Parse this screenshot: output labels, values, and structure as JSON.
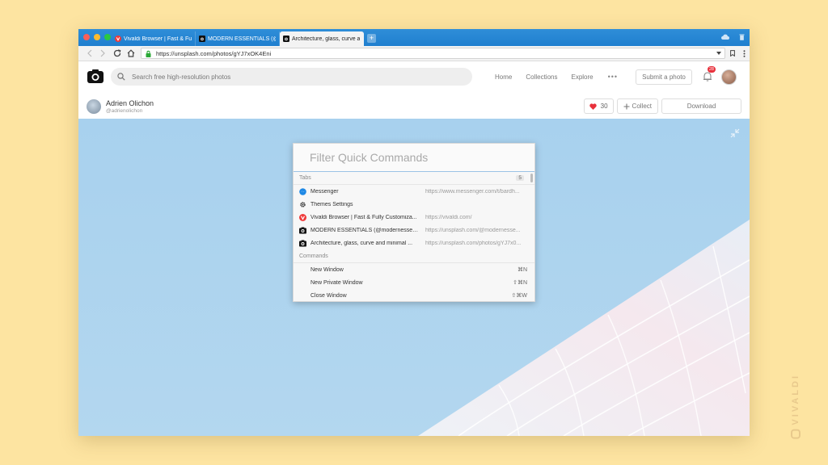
{
  "browser": {
    "tabs": [
      {
        "label": "Vivaldi Browser | Fast & Fully C",
        "favicon": "vivaldi-icon",
        "active": false
      },
      {
        "label": "MODERN ESSENTIALS (@moder",
        "favicon": "camera-icon",
        "active": false
      },
      {
        "label": "Architecture, glass, curve and",
        "favicon": "camera-icon",
        "active": true
      }
    ],
    "url": "https://unsplash.com/photos/gYJ7xOK4Eni",
    "colors": {
      "tabbar": "#2f8ed8",
      "close": "#fc5f57",
      "minimize": "#fdbb2f",
      "maximize": "#2ac840"
    }
  },
  "site": {
    "search_placeholder": "Search free high-resolution photos",
    "nav": [
      "Home",
      "Collections",
      "Explore"
    ],
    "more": "•••",
    "submit_label": "Submit a photo",
    "notification_count": "28"
  },
  "photo_header": {
    "author_name": "Adrien Olichon",
    "author_handle": "@adrienolichon",
    "likes": "30",
    "collect_label": "Collect",
    "download_label": "Download"
  },
  "quick_commands": {
    "placeholder": "Filter Quick Commands",
    "tabs_section": "Tabs",
    "tabs_count": "5",
    "tab_items": [
      {
        "title": "Messenger",
        "url": "https://www.messenger.com/t/bardh...",
        "icon": "messenger-icon"
      },
      {
        "title": "Themes Settings",
        "url": "",
        "icon": "gear-icon"
      },
      {
        "title": "Vivaldi Browser | Fast & Fully Customiza...",
        "url": "https://vivaldi.com/",
        "icon": "vivaldi-icon"
      },
      {
        "title": "MODERN ESSENTIALS (@modernessenti...",
        "url": "https://unsplash.com/@modernesse...",
        "icon": "camera-icon"
      },
      {
        "title": "Architecture, glass, curve and minimal ...",
        "url": "https://unsplash.com/photos/gYJ7x0...",
        "icon": "camera-icon"
      }
    ],
    "commands_section": "Commands",
    "command_items": [
      {
        "title": "New Window",
        "shortcut": "⌘N"
      },
      {
        "title": "New Private Window",
        "shortcut": "⇧⌘N"
      },
      {
        "title": "Close Window",
        "shortcut": "⇧⌘W"
      }
    ]
  },
  "watermark": "VIVALDI"
}
